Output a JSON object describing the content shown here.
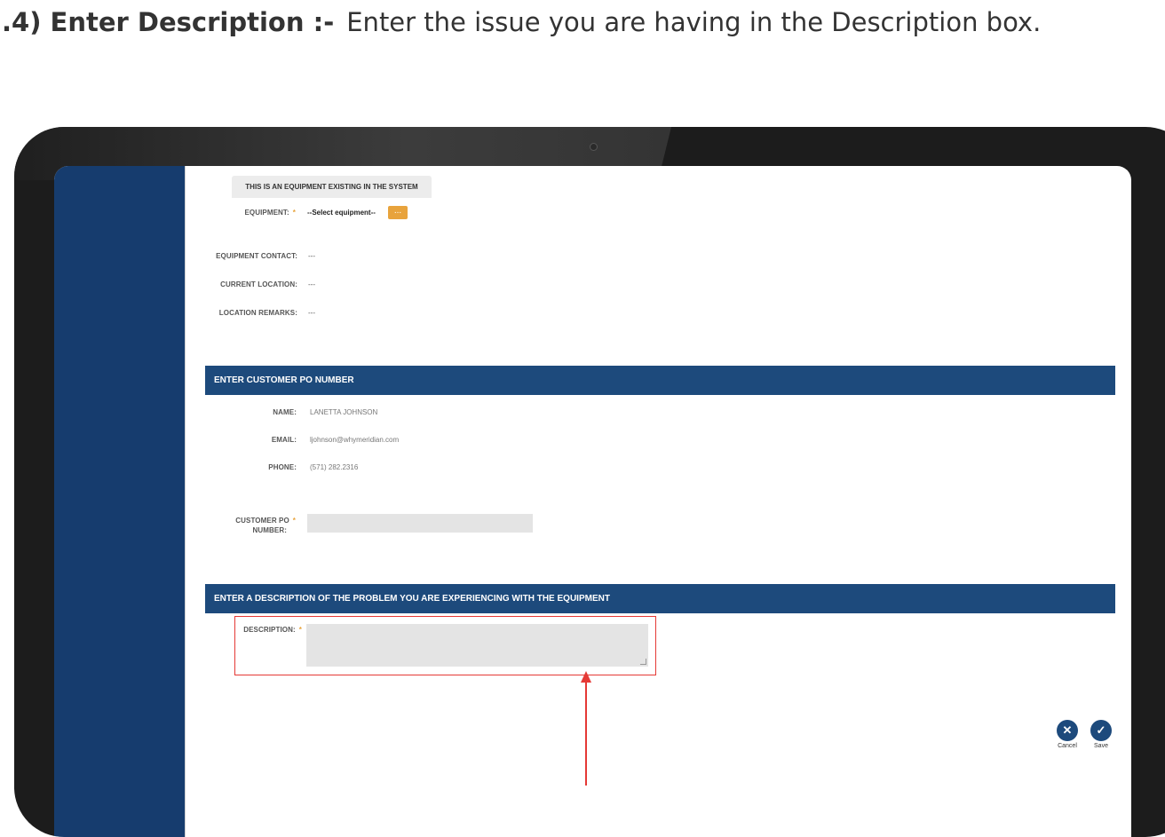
{
  "heading": {
    "step": ".4) Enter Description :-",
    "text": "Enter the issue you are having in the Description box."
  },
  "equipment_section": {
    "tab_label": "THIS IS AN EQUIPMENT EXISTING IN THE SYSTEM",
    "equipment_label": "EQUIPMENT:",
    "equipment_value": "--Select equipment--",
    "browse_button": "...",
    "contact_label": "EQUIPMENT CONTACT:",
    "contact_value": "---",
    "location_label": "CURRENT LOCATION:",
    "location_value": "---",
    "remarks_label": "LOCATION REMARKS:",
    "remarks_value": "---"
  },
  "po_section": {
    "title": "ENTER CUSTOMER PO NUMBER",
    "name_label": "NAME:",
    "name_value": "LANETTA JOHNSON",
    "email_label": "EMAIL:",
    "email_value": "ljohnson@whymeridian.com",
    "phone_label": "PHONE:",
    "phone_value": "(571) 282.2316",
    "po_label_line1": "CUSTOMER PO",
    "po_label_line2": "NUMBER:",
    "po_value": ""
  },
  "description_section": {
    "title": "ENTER A DESCRIPTION OF THE PROBLEM YOU ARE EXPERIENCING WITH THE EQUIPMENT",
    "description_label": "DESCRIPTION:",
    "description_value": ""
  },
  "required_marker": "*",
  "actions": {
    "cancel_label": "Cancel",
    "save_label": "Save"
  },
  "colors": {
    "sidebar": "#163c6e",
    "section_bar": "#1d4a7c",
    "accent": "#e8a33c",
    "highlight": "#e53935"
  }
}
